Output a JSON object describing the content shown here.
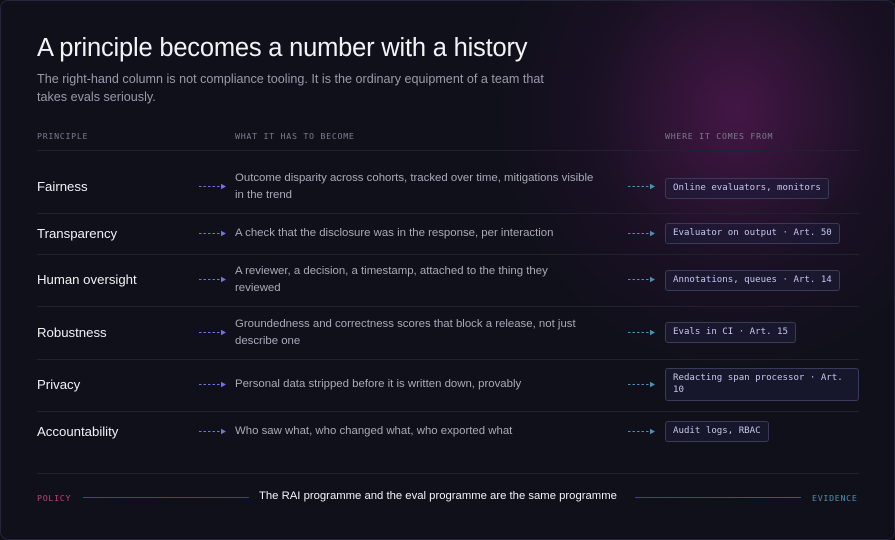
{
  "header": {
    "title": "A principle becomes a number with a history",
    "subtitle": "The right-hand column is not compliance tooling. It is the ordinary equipment of a team that takes evals seriously."
  },
  "columns": {
    "principle": "PRINCIPLE",
    "what": "WHAT IT HAS TO BECOME",
    "where": "WHERE IT COMES FROM"
  },
  "rows": [
    {
      "principle": "Fairness",
      "what": "Outcome disparity across cohorts, tracked over time, mitigations visible in the trend",
      "source": "Online evaluators, monitors"
    },
    {
      "principle": "Transparency",
      "what": "A check that the disclosure was in the response, per interaction",
      "source": "Evaluator on output · Art. 50"
    },
    {
      "principle": "Human oversight",
      "what": "A reviewer, a decision, a timestamp, attached to the thing they reviewed",
      "source": "Annotations, queues · Art. 14"
    },
    {
      "principle": "Robustness",
      "what": "Groundedness and correctness scores that block a release, not just describe one",
      "source": "Evals in CI · Art. 15"
    },
    {
      "principle": "Privacy",
      "what": "Personal data stripped before it is written down, provably",
      "source": "Redacting span processor · Art. 10"
    },
    {
      "principle": "Accountability",
      "what": "Who saw what, who changed what, who exported what",
      "source": "Audit logs, RBAC"
    }
  ],
  "footer": {
    "left_label": "POLICY",
    "text": "The RAI programme and the eval programme are the same programme",
    "right_label": "EVIDENCE"
  },
  "colors": {
    "policy": "#c2417a",
    "evidence": "#4d8fb3",
    "arrow_left": "#6f72e8",
    "arrow_right": "#4d8fb3"
  }
}
